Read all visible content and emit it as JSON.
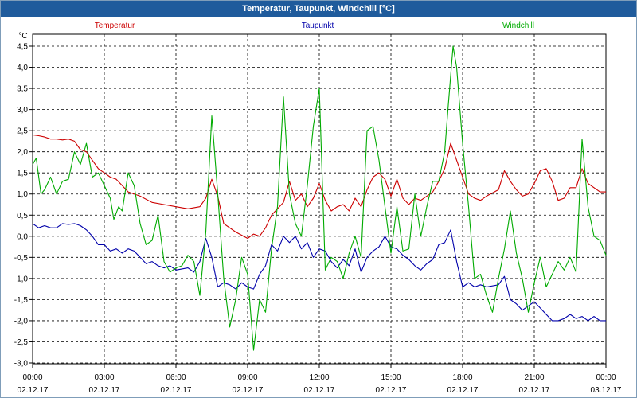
{
  "window": {
    "title": "Temperatur, Taupunkt, Windchill [°C]"
  },
  "chart_data": {
    "type": "line",
    "title": "Temperatur, Taupunkt, Windchill [°C]",
    "ylabel": "°C",
    "ylim": [
      -3.0,
      4.5
    ],
    "yticks": [
      4.5,
      4.0,
      3.5,
      3.0,
      2.5,
      2.0,
      1.5,
      1.0,
      0.5,
      0.0,
      -0.5,
      -1.0,
      -1.5,
      -2.0,
      -2.5,
      -3.0
    ],
    "ytick_labels": [
      "4,5",
      "4,0",
      "3,5",
      "3,0",
      "2,5",
      "2,0",
      "1,5",
      "1,0",
      "0,5",
      "0,0",
      "-0,5",
      "-1,0",
      "-1,5",
      "-2,0",
      "-2,5",
      "-3,0"
    ],
    "xlim_hours": [
      0,
      24
    ],
    "xticks": [
      {
        "time": "00:00",
        "date": "02.12.17"
      },
      {
        "time": "03:00",
        "date": "02.12.17"
      },
      {
        "time": "06:00",
        "date": "02.12.17"
      },
      {
        "time": "09:00",
        "date": "02.12.17"
      },
      {
        "time": "12:00",
        "date": "02.12.17"
      },
      {
        "time": "15:00",
        "date": "02.12.17"
      },
      {
        "time": "18:00",
        "date": "02.12.17"
      },
      {
        "time": "21:00",
        "date": "02.12.17"
      },
      {
        "time": "00:00",
        "date": "03.12.17"
      }
    ],
    "grid": true,
    "legend_position": "top",
    "series": [
      {
        "name": "Temperatur",
        "color": "#cc0000",
        "points": [
          [
            0,
            2.4
          ],
          [
            0.25,
            2.38
          ],
          [
            0.5,
            2.35
          ],
          [
            0.75,
            2.3
          ],
          [
            1,
            2.3
          ],
          [
            1.25,
            2.28
          ],
          [
            1.5,
            2.3
          ],
          [
            1.75,
            2.25
          ],
          [
            2,
            2.05
          ],
          [
            2.25,
            2.0
          ],
          [
            2.5,
            1.8
          ],
          [
            2.75,
            1.6
          ],
          [
            3,
            1.5
          ],
          [
            3.25,
            1.4
          ],
          [
            3.5,
            1.35
          ],
          [
            3.75,
            1.2
          ],
          [
            4,
            1.05
          ],
          [
            4.5,
            0.95
          ],
          [
            5,
            0.8
          ],
          [
            5.5,
            0.75
          ],
          [
            6,
            0.7
          ],
          [
            6.5,
            0.65
          ],
          [
            7,
            0.7
          ],
          [
            7.25,
            0.9
          ],
          [
            7.5,
            1.35
          ],
          [
            7.75,
            0.95
          ],
          [
            8,
            0.3
          ],
          [
            8.5,
            0.1
          ],
          [
            9,
            -0.05
          ],
          [
            9.25,
            0.05
          ],
          [
            9.5,
            0.0
          ],
          [
            9.75,
            0.2
          ],
          [
            10,
            0.5
          ],
          [
            10.5,
            0.8
          ],
          [
            10.75,
            1.3
          ],
          [
            11,
            0.85
          ],
          [
            11.25,
            1.0
          ],
          [
            11.5,
            0.7
          ],
          [
            11.75,
            0.9
          ],
          [
            12,
            1.25
          ],
          [
            12.25,
            0.85
          ],
          [
            12.5,
            0.6
          ],
          [
            12.75,
            0.7
          ],
          [
            13,
            0.75
          ],
          [
            13.25,
            0.6
          ],
          [
            13.5,
            0.9
          ],
          [
            13.75,
            0.7
          ],
          [
            14,
            1.1
          ],
          [
            14.25,
            1.4
          ],
          [
            14.5,
            1.5
          ],
          [
            14.75,
            1.35
          ],
          [
            15,
            0.95
          ],
          [
            15.25,
            1.35
          ],
          [
            15.5,
            0.9
          ],
          [
            15.75,
            0.75
          ],
          [
            16,
            0.9
          ],
          [
            16.25,
            0.85
          ],
          [
            16.5,
            0.95
          ],
          [
            16.75,
            1.05
          ],
          [
            17,
            1.3
          ],
          [
            17.25,
            1.6
          ],
          [
            17.5,
            2.2
          ],
          [
            17.75,
            1.8
          ],
          [
            18,
            1.4
          ],
          [
            18.25,
            1.0
          ],
          [
            18.5,
            0.9
          ],
          [
            18.75,
            0.85
          ],
          [
            19,
            0.95
          ],
          [
            19.5,
            1.1
          ],
          [
            19.75,
            1.55
          ],
          [
            20,
            1.3
          ],
          [
            20.25,
            1.1
          ],
          [
            20.5,
            0.95
          ],
          [
            20.75,
            1.0
          ],
          [
            21,
            1.25
          ],
          [
            21.25,
            1.55
          ],
          [
            21.5,
            1.6
          ],
          [
            21.75,
            1.3
          ],
          [
            22,
            0.85
          ],
          [
            22.25,
            0.9
          ],
          [
            22.5,
            1.15
          ],
          [
            22.75,
            1.15
          ],
          [
            23,
            1.6
          ],
          [
            23.25,
            1.25
          ],
          [
            23.5,
            1.15
          ],
          [
            23.75,
            1.05
          ],
          [
            24,
            1.05
          ]
        ]
      },
      {
        "name": "Taupunkt",
        "color": "#0000aa",
        "points": [
          [
            0,
            0.3
          ],
          [
            0.25,
            0.2
          ],
          [
            0.5,
            0.25
          ],
          [
            0.75,
            0.2
          ],
          [
            1,
            0.2
          ],
          [
            1.25,
            0.3
          ],
          [
            1.5,
            0.28
          ],
          [
            1.75,
            0.3
          ],
          [
            2,
            0.25
          ],
          [
            2.25,
            0.15
          ],
          [
            2.5,
            0.0
          ],
          [
            2.75,
            -0.2
          ],
          [
            3,
            -0.2
          ],
          [
            3.25,
            -0.35
          ],
          [
            3.5,
            -0.3
          ],
          [
            3.75,
            -0.4
          ],
          [
            4,
            -0.3
          ],
          [
            4.25,
            -0.35
          ],
          [
            4.5,
            -0.5
          ],
          [
            4.75,
            -0.65
          ],
          [
            5,
            -0.6
          ],
          [
            5.25,
            -0.7
          ],
          [
            5.5,
            -0.75
          ],
          [
            5.75,
            -0.7
          ],
          [
            6,
            -0.8
          ],
          [
            6.5,
            -0.75
          ],
          [
            6.75,
            -0.85
          ],
          [
            7,
            -0.6
          ],
          [
            7.25,
            -0.05
          ],
          [
            7.5,
            -0.5
          ],
          [
            7.75,
            -1.2
          ],
          [
            8,
            -1.1
          ],
          [
            8.25,
            -1.15
          ],
          [
            8.5,
            -1.25
          ],
          [
            8.75,
            -1.1
          ],
          [
            9,
            -1.2
          ],
          [
            9.25,
            -1.25
          ],
          [
            9.5,
            -0.9
          ],
          [
            9.75,
            -0.7
          ],
          [
            10,
            -0.2
          ],
          [
            10.25,
            -0.35
          ],
          [
            10.5,
            0.0
          ],
          [
            10.75,
            -0.15
          ],
          [
            11,
            0.0
          ],
          [
            11.25,
            -0.3
          ],
          [
            11.5,
            -0.15
          ],
          [
            11.75,
            -0.5
          ],
          [
            12,
            -0.3
          ],
          [
            12.25,
            -0.35
          ],
          [
            12.5,
            -0.6
          ],
          [
            12.75,
            -0.75
          ],
          [
            13,
            -0.55
          ],
          [
            13.25,
            -0.7
          ],
          [
            13.5,
            -0.3
          ],
          [
            13.75,
            -0.85
          ],
          [
            14,
            -0.5
          ],
          [
            14.25,
            -0.35
          ],
          [
            14.5,
            -0.25
          ],
          [
            14.75,
            0.0
          ],
          [
            15,
            -0.25
          ],
          [
            15.25,
            -0.3
          ],
          [
            15.5,
            -0.45
          ],
          [
            15.75,
            -0.55
          ],
          [
            16,
            -0.7
          ],
          [
            16.25,
            -0.8
          ],
          [
            16.5,
            -0.65
          ],
          [
            16.75,
            -0.55
          ],
          [
            17,
            -0.2
          ],
          [
            17.25,
            -0.15
          ],
          [
            17.5,
            0.15
          ],
          [
            17.75,
            -0.6
          ],
          [
            18,
            -1.2
          ],
          [
            18.25,
            -1.1
          ],
          [
            18.5,
            -1.2
          ],
          [
            18.75,
            -1.15
          ],
          [
            19,
            -1.2
          ],
          [
            19.5,
            -1.15
          ],
          [
            19.75,
            -0.95
          ],
          [
            20,
            -1.5
          ],
          [
            20.25,
            -1.6
          ],
          [
            20.5,
            -1.75
          ],
          [
            20.75,
            -1.65
          ],
          [
            21,
            -1.55
          ],
          [
            21.25,
            -1.7
          ],
          [
            21.5,
            -1.85
          ],
          [
            21.75,
            -2.0
          ],
          [
            22,
            -2.0
          ],
          [
            22.25,
            -1.95
          ],
          [
            22.5,
            -1.85
          ],
          [
            22.75,
            -1.95
          ],
          [
            23,
            -1.9
          ],
          [
            23.25,
            -2.0
          ],
          [
            23.5,
            -1.9
          ],
          [
            23.75,
            -2.0
          ],
          [
            24,
            -2.0
          ]
        ]
      },
      {
        "name": "Windchill",
        "color": "#00aa00",
        "points": [
          [
            0,
            1.7
          ],
          [
            0.15,
            1.85
          ],
          [
            0.35,
            1.0
          ],
          [
            0.5,
            1.1
          ],
          [
            0.75,
            1.4
          ],
          [
            1,
            1.0
          ],
          [
            1.25,
            1.3
          ],
          [
            1.5,
            1.35
          ],
          [
            1.75,
            2.0
          ],
          [
            2,
            1.7
          ],
          [
            2.25,
            2.2
          ],
          [
            2.5,
            1.4
          ],
          [
            2.75,
            1.5
          ],
          [
            3,
            1.2
          ],
          [
            3.25,
            0.9
          ],
          [
            3.4,
            0.4
          ],
          [
            3.6,
            0.7
          ],
          [
            3.75,
            0.6
          ],
          [
            4,
            1.5
          ],
          [
            4.25,
            1.2
          ],
          [
            4.5,
            0.3
          ],
          [
            4.75,
            -0.2
          ],
          [
            5,
            -0.1
          ],
          [
            5.25,
            0.5
          ],
          [
            5.5,
            -0.6
          ],
          [
            5.75,
            -0.85
          ],
          [
            6,
            -0.75
          ],
          [
            6.25,
            -0.7
          ],
          [
            6.5,
            -0.45
          ],
          [
            6.75,
            -0.6
          ],
          [
            7,
            -1.4
          ],
          [
            7.25,
            0.1
          ],
          [
            7.5,
            2.85
          ],
          [
            7.75,
            1.0
          ],
          [
            8,
            -1.0
          ],
          [
            8.25,
            -2.15
          ],
          [
            8.5,
            -1.5
          ],
          [
            8.75,
            -0.5
          ],
          [
            9,
            -0.9
          ],
          [
            9.25,
            -2.7
          ],
          [
            9.5,
            -1.5
          ],
          [
            9.75,
            -1.8
          ],
          [
            10,
            -0.3
          ],
          [
            10.25,
            0.7
          ],
          [
            10.5,
            3.3
          ],
          [
            10.75,
            1.0
          ],
          [
            11,
            0.3
          ],
          [
            11.25,
            0.0
          ],
          [
            11.5,
            1.2
          ],
          [
            11.75,
            2.6
          ],
          [
            12,
            3.5
          ],
          [
            12.25,
            -0.8
          ],
          [
            12.5,
            -0.5
          ],
          [
            12.75,
            -0.6
          ],
          [
            13,
            -1.0
          ],
          [
            13.25,
            -0.4
          ],
          [
            13.5,
            0.0
          ],
          [
            13.75,
            -0.5
          ],
          [
            14,
            2.5
          ],
          [
            14.25,
            2.6
          ],
          [
            14.5,
            1.8
          ],
          [
            14.75,
            0.7
          ],
          [
            15,
            -0.4
          ],
          [
            15.25,
            0.7
          ],
          [
            15.5,
            -0.35
          ],
          [
            15.75,
            -0.3
          ],
          [
            16,
            1.0
          ],
          [
            16.25,
            0.0
          ],
          [
            16.5,
            0.7
          ],
          [
            16.75,
            1.3
          ],
          [
            17,
            1.3
          ],
          [
            17.25,
            2.0
          ],
          [
            17.4,
            3.1
          ],
          [
            17.6,
            4.5
          ],
          [
            17.75,
            4.0
          ],
          [
            18,
            2.2
          ],
          [
            18.25,
            0.7
          ],
          [
            18.5,
            -1.0
          ],
          [
            18.75,
            -0.9
          ],
          [
            19,
            -1.4
          ],
          [
            19.25,
            -1.8
          ],
          [
            19.5,
            -1.0
          ],
          [
            19.75,
            -0.3
          ],
          [
            20,
            0.6
          ],
          [
            20.25,
            -0.4
          ],
          [
            20.5,
            -1.0
          ],
          [
            20.75,
            -1.8
          ],
          [
            21,
            -1.1
          ],
          [
            21.25,
            -0.5
          ],
          [
            21.5,
            -1.2
          ],
          [
            21.75,
            -0.9
          ],
          [
            22,
            -0.6
          ],
          [
            22.25,
            -0.8
          ],
          [
            22.5,
            -0.5
          ],
          [
            22.75,
            -0.85
          ],
          [
            23,
            2.3
          ],
          [
            23.25,
            0.7
          ],
          [
            23.5,
            0.0
          ],
          [
            23.75,
            -0.1
          ],
          [
            24,
            -0.45
          ]
        ]
      }
    ]
  }
}
